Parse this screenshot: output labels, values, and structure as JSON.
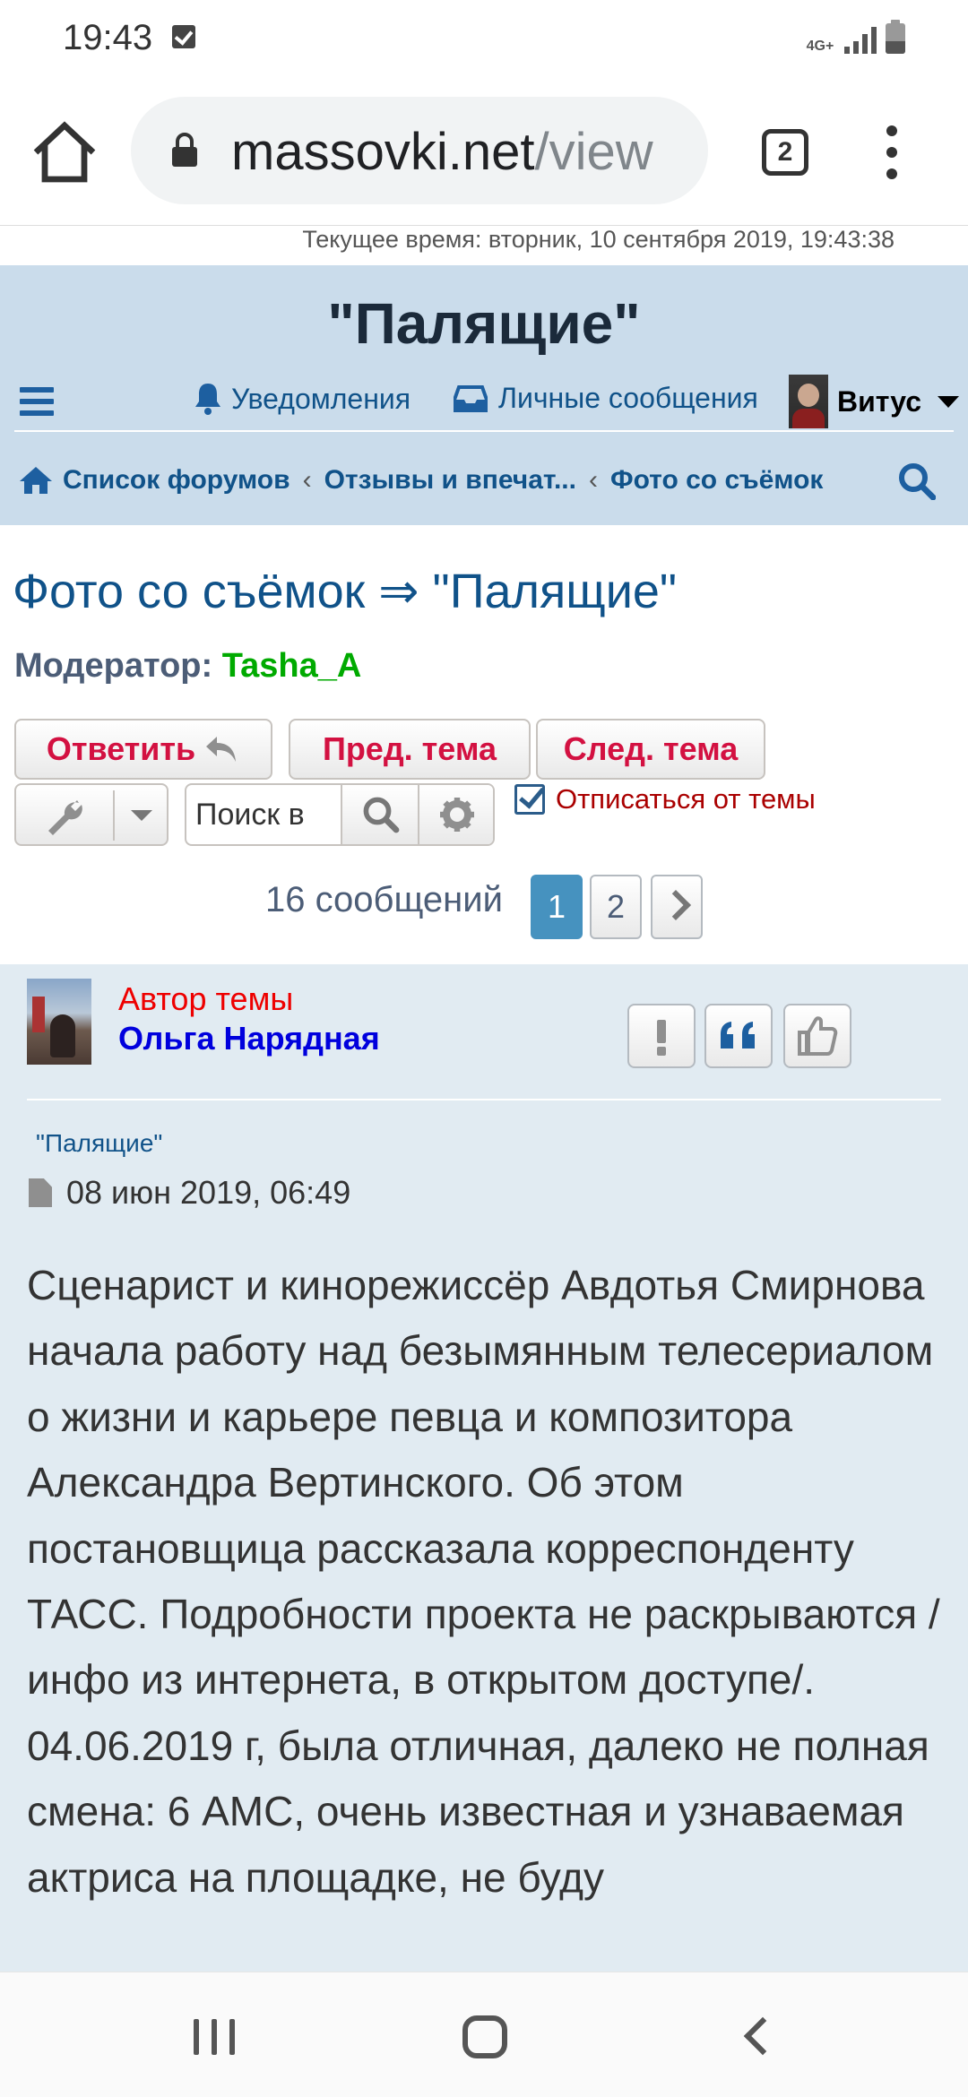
{
  "status_bar": {
    "time": "19:43",
    "network": "4G+",
    "icons": [
      "checkbox-notification-icon",
      "signal-icon",
      "battery-icon"
    ]
  },
  "browser": {
    "url_host": "massovki.net",
    "url_path": "/view",
    "tab_count": "2",
    "icons": [
      "home-icon",
      "lock-icon",
      "more-vert-icon"
    ]
  },
  "forum": {
    "current_time": "Текущее время: вторник, 10 сентября 2019, 19:43:38",
    "site_title": "\"Палящие\"",
    "nav": {
      "notifications": "Уведомления",
      "messages": "Личные сообщения",
      "user_name": "Витус"
    },
    "breadcrumbs": [
      "Список форумов",
      "Отзывы и впечат...",
      "Фото со съёмок"
    ]
  },
  "topic": {
    "title": "Фото со съёмок ⇒ \"Палящие\"",
    "moderator_label": "Модератор:",
    "moderator_name": "Tasha_A",
    "reply_button": "Ответить",
    "prev_button": "Пред. тема",
    "next_button": "След. тема",
    "search_placeholder": "Поиск в",
    "unsubscribe": "Отписаться от темы",
    "message_count": "16 сообщений",
    "pages": [
      "1",
      "2"
    ],
    "current_page": "1"
  },
  "post": {
    "author_role": "Автор темы",
    "author_name": "Ольга Нарядная",
    "subject": "\"Палящие\"",
    "date": "08 июн 2019, 06:49",
    "body": "Сценарист и кинорежиссёр Авдотья Смирнова начала работу над безымянным телесериалом о жизни и карьере певца и композитора Александра Вертинского. Об этом постановщица рассказала корреспонденту ТАСС. Подробности проекта не раскрываются / инфо из интернета, в открытом доступе/. 04.06.2019 г, была отличная, далеко не полная смена: 6 АМС, очень известная и узнаваемая актриса на площадке, не буду"
  },
  "colors": {
    "header_bg": "#cadceb",
    "post_bg": "#e1ebf2",
    "link_blue": "#105289",
    "button_red": "#d31141",
    "moderator_green": "#00aa00",
    "author_red": "#ee0000",
    "author_blue": "#0000dd",
    "active_page": "#4692bf"
  }
}
